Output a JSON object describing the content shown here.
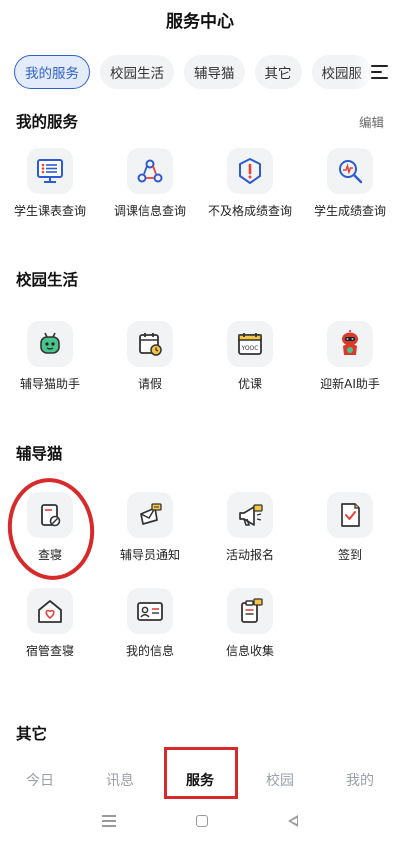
{
  "header": {
    "title": "服务中心"
  },
  "tabs": [
    {
      "label": "我的服务",
      "active": true
    },
    {
      "label": "校园生活",
      "active": false
    },
    {
      "label": "辅导猫",
      "active": false
    },
    {
      "label": "其它",
      "active": false
    },
    {
      "label": "校园服",
      "active": false
    }
  ],
  "sections": {
    "my_services": {
      "title": "我的服务",
      "edit_label": "编辑",
      "items": [
        {
          "label": "学生课表查询",
          "icon": "timetable-icon"
        },
        {
          "label": "调课信息查询",
          "icon": "course-adjust-icon"
        },
        {
          "label": "不及格成绩查询",
          "icon": "alert-icon"
        },
        {
          "label": "学生成绩查询",
          "icon": "grade-search-icon"
        }
      ]
    },
    "campus_life": {
      "title": "校园生活",
      "items": [
        {
          "label": "辅导猫助手",
          "icon": "robot-icon"
        },
        {
          "label": "请假",
          "icon": "calendar-clock-icon"
        },
        {
          "label": "优课",
          "icon": "yooc-icon",
          "text": "YOOC"
        },
        {
          "label": "迎新AI助手",
          "icon": "ai-assistant-icon"
        }
      ]
    },
    "fudaomao": {
      "title": "辅导猫",
      "items": [
        {
          "label": "查寝",
          "icon": "dorm-check-icon"
        },
        {
          "label": "辅导员通知",
          "icon": "notice-icon"
        },
        {
          "label": "活动报名",
          "icon": "megaphone-icon"
        },
        {
          "label": "签到",
          "icon": "checkin-icon"
        },
        {
          "label": "宿管查寝",
          "icon": "house-heart-icon"
        },
        {
          "label": "我的信息",
          "icon": "id-card-icon"
        },
        {
          "label": "信息收集",
          "icon": "clipboard-icon"
        }
      ]
    },
    "other": {
      "title": "其它"
    }
  },
  "bottom_nav": [
    {
      "label": "今日",
      "active": false
    },
    {
      "label": "讯息",
      "active": false
    },
    {
      "label": "服务",
      "active": true
    },
    {
      "label": "校园",
      "active": false
    },
    {
      "label": "我的",
      "active": false
    }
  ],
  "colors": {
    "accent": "#2f62c8",
    "annotation": "#d72b2b"
  }
}
